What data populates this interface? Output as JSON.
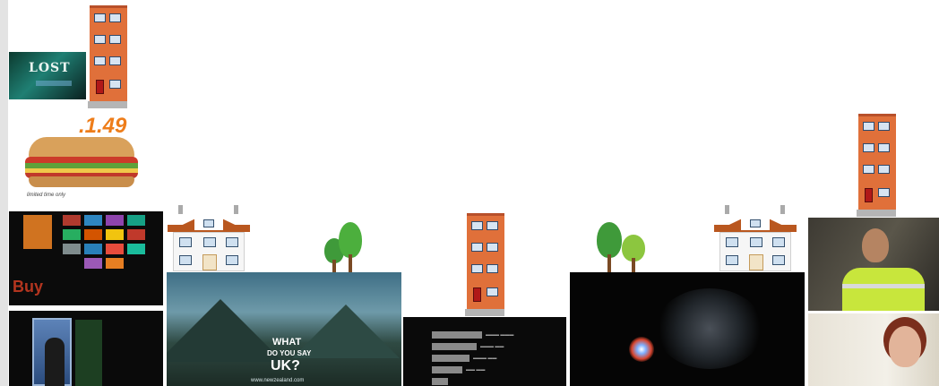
{
  "tiles": {
    "lost_title": "LOST",
    "sub_price": ".1.49",
    "sub_note": "limited time only",
    "buy_text": "Buy",
    "ad_question_line1": "WHAT",
    "ad_question_line2": "DO YOU SAY",
    "ad_question_line3": "UK?",
    "ad_url": "www.newzealand.com"
  },
  "icons": {
    "building": "apartment-building-icon",
    "house": "house-icon",
    "trees": "trees-icon"
  },
  "colors": {
    "building": "#e0703a",
    "roof": "#b9571f",
    "tree_dark": "#3f9a3a",
    "tree_light": "#8cc63f",
    "vest": "#c8e63c"
  }
}
